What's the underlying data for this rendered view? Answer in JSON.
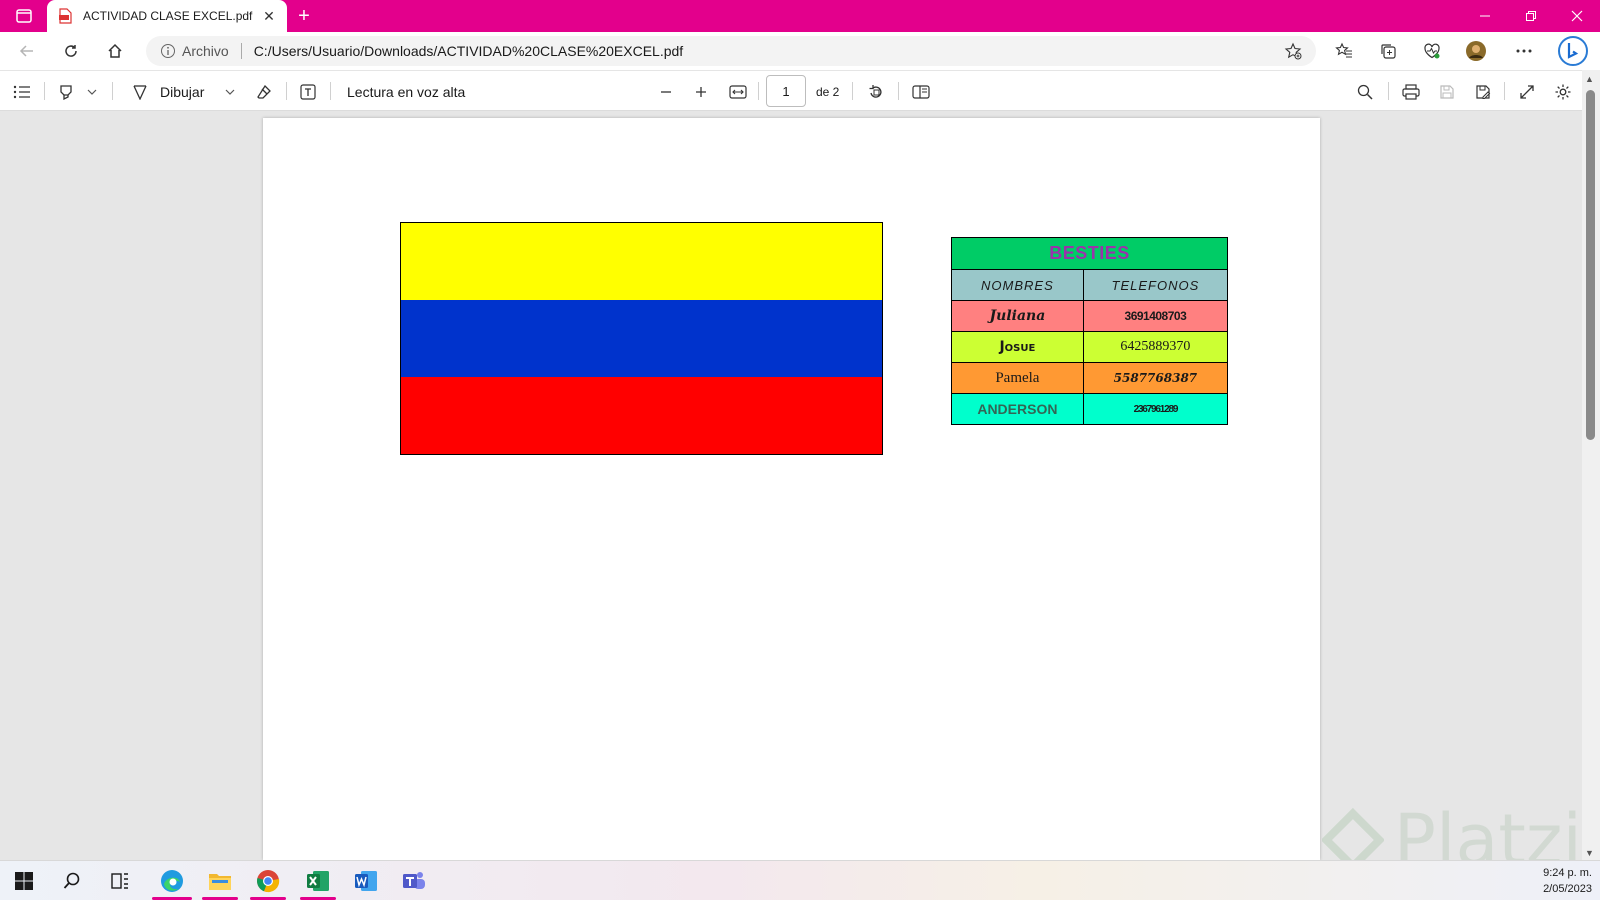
{
  "browser": {
    "tab_title": "ACTIVIDAD CLASE EXCEL.pdf",
    "site_label": "Archivo",
    "url": "C:/Users/Usuario/Downloads/ACTIVIDAD%20CLASE%20EXCEL.pdf",
    "accent_color": "#e3008c"
  },
  "pdf_toolbar": {
    "draw_label": "Dibujar",
    "read_aloud_label": "Lectura en voz alta",
    "page_number": "1",
    "page_total": "de 2"
  },
  "document": {
    "flag_colors": [
      "#ffff00",
      "#0033cc",
      "#ff0000"
    ],
    "table": {
      "title": "BESTIES",
      "headers": [
        "NOMBRES",
        "TELEFONOS"
      ],
      "rows": [
        {
          "name": "Juliana",
          "phone": "3691408703",
          "color": "#ff8080"
        },
        {
          "name": "Josue",
          "phone": "6425889370",
          "color": "#ccff33"
        },
        {
          "name": "Pamela",
          "phone": "5587768387",
          "color": "#ff9933"
        },
        {
          "name": "ANDERSON",
          "phone": "2367961289",
          "color": "#00ffcc"
        }
      ]
    }
  },
  "watermark": "Platzi",
  "taskbar": {
    "time": "9:24 p. m.",
    "date": "2/05/2023",
    "apps": [
      "start-icon",
      "search-icon",
      "task-view-icon",
      "edge-icon",
      "file-explorer-icon",
      "chrome-icon",
      "excel-icon",
      "word-icon",
      "teams-icon"
    ]
  }
}
